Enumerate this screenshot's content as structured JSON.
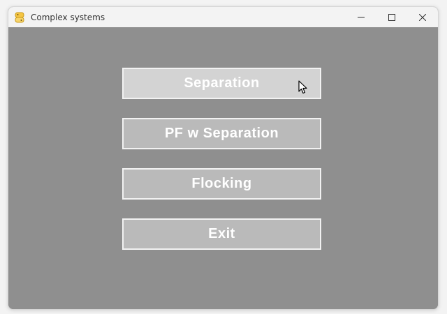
{
  "window": {
    "title": "Complex systems",
    "icon": "python-icon"
  },
  "controls": {
    "minimize": "minimize-icon",
    "maximize": "maximize-icon",
    "close": "close-icon"
  },
  "menu": {
    "buttons": [
      {
        "label": "Separation",
        "state": "hover"
      },
      {
        "label": "PF w Separation",
        "state": "normal"
      },
      {
        "label": "Flocking",
        "state": "normal"
      },
      {
        "label": "Exit",
        "state": "normal"
      }
    ]
  },
  "colors": {
    "background": "#8f8f8f",
    "button": "#bababa",
    "button_hover": "#d3d3d3",
    "button_border": "#f2f2f2",
    "button_text": "#ffffff"
  }
}
